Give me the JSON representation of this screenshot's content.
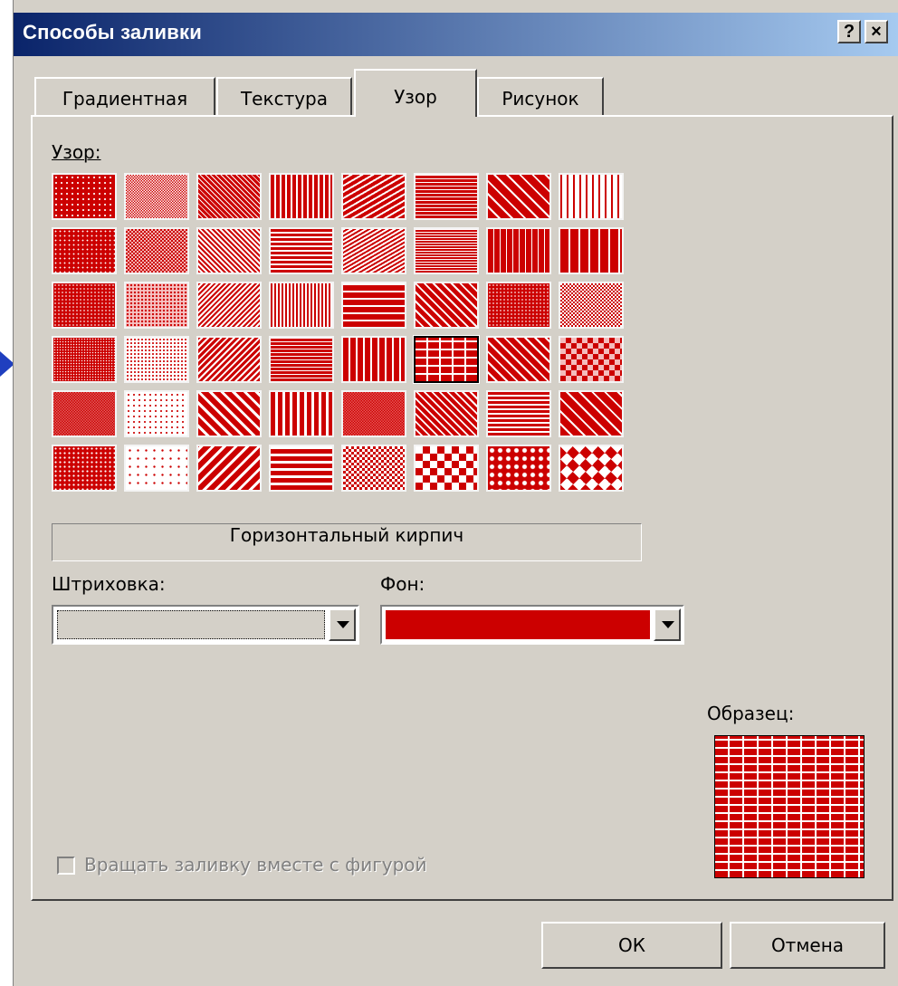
{
  "window": {
    "title": "Способы заливки",
    "help_label": "?",
    "close_label": "×"
  },
  "tabs": [
    {
      "label": "Градиентная",
      "active": false
    },
    {
      "label": "Текстура",
      "active": false
    },
    {
      "label": "Узор",
      "active": true
    },
    {
      "label": "Рисунок",
      "active": false
    }
  ],
  "pattern_section": {
    "label": "Узор:",
    "rows": 6,
    "columns": 8,
    "selected_row": 4,
    "selected_col": 6,
    "selected_name": "Горизонтальный кирпич"
  },
  "colors": {
    "pattern_fg": "#cc0000",
    "pattern_bg": "#ffffff",
    "foreground_swatch": "#d4d0c8",
    "background_swatch": "#cc0000"
  },
  "hatch": {
    "label": "Штриховка:"
  },
  "background": {
    "label": "Фон:"
  },
  "preview": {
    "label": "Образец:"
  },
  "rotate_checkbox": {
    "label": "Вращать заливку вместе с фигурой",
    "checked": false,
    "enabled": false
  },
  "buttons": {
    "ok": "ОК",
    "cancel": "Отмена"
  }
}
